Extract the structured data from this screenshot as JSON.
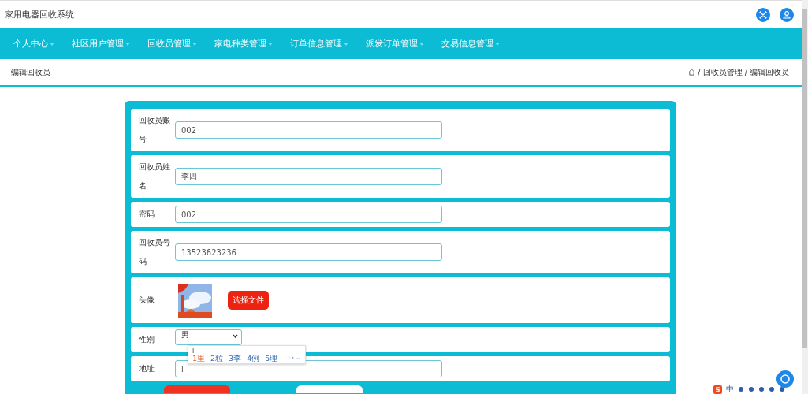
{
  "header": {
    "title": "家用电器回收系统"
  },
  "nav": [
    {
      "label": "个人中心"
    },
    {
      "label": "社区用户管理"
    },
    {
      "label": "回收员管理"
    },
    {
      "label": "家电种类管理"
    },
    {
      "label": "订单信息管理"
    },
    {
      "label": "派发订单管理"
    },
    {
      "label": "交易信息管理"
    }
  ],
  "page_title": "编辑回收员",
  "breadcrumb": [
    "回收员管理",
    "编辑回收员"
  ],
  "breadcrumb_separator": "/",
  "form": {
    "fields": [
      {
        "kind": "input",
        "label": "回收员账号",
        "value": "002"
      },
      {
        "kind": "input",
        "label": "回收员姓名",
        "value": "李四"
      },
      {
        "kind": "input",
        "label": "密码",
        "value": "002"
      },
      {
        "kind": "input",
        "label": "回收员号码",
        "value": "13523623236"
      },
      {
        "label": "头像",
        "button": "选择文件"
      },
      {
        "kind": "select",
        "label": "性别",
        "value": "男"
      },
      {
        "kind": "input",
        "label": "地址",
        "value": "l"
      }
    ]
  },
  "ime_popup": {
    "input": "l",
    "candidates": [
      "1里",
      "2粒",
      "3李",
      "4例",
      "5理"
    ],
    "more": "‹ › ⌄"
  },
  "ime_bar": {
    "mode": "中"
  }
}
